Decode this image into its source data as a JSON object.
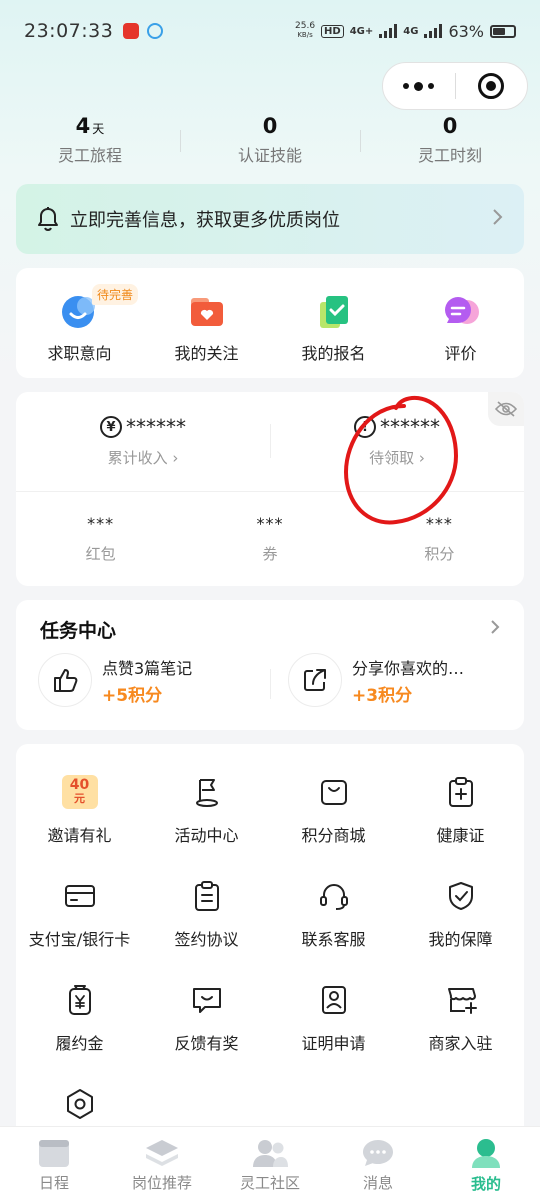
{
  "status_bar": {
    "time": "23:07:33",
    "net_speed_value": "25.6",
    "net_speed_unit": "KB/s",
    "hd_badge": "HD",
    "signal_1": "4G+",
    "signal_2": "4G",
    "battery_percent": "63%",
    "battery_level": 0.63
  },
  "capsule": {
    "more_icon": "more-dots-icon",
    "close_icon": "target-icon"
  },
  "stats": [
    {
      "value": "4",
      "unit": "天",
      "label": "灵工旅程"
    },
    {
      "value": "0",
      "unit": "",
      "label": "认证技能"
    },
    {
      "value": "0",
      "unit": "",
      "label": "灵工时刻"
    }
  ],
  "notice": {
    "text": "立即完善信息，获取更多优质岗位",
    "icon": "bell-icon"
  },
  "quick_actions": {
    "pending_tag": "待完善",
    "items": [
      {
        "label": "求职意向",
        "icon": "smile-face-icon",
        "color": "#3a8ff0"
      },
      {
        "label": "我的关注",
        "icon": "heart-folder-icon",
        "color": "#f25c3b"
      },
      {
        "label": "我的报名",
        "icon": "check-doc-icon",
        "color": "#26c281"
      },
      {
        "label": "评价",
        "icon": "chat-bubble-icon",
        "color": "#b45cf0"
      }
    ]
  },
  "money": {
    "income_value": "******",
    "income_label": "累计收入",
    "pending_value": "******",
    "pending_label": "待领取",
    "mini": [
      {
        "value": "***",
        "label": "红包"
      },
      {
        "value": "***",
        "label": "券"
      },
      {
        "value": "***",
        "label": "积分"
      }
    ]
  },
  "tasks": {
    "title": "任务中心",
    "items": [
      {
        "name": "点赞3篇笔记",
        "reward": "+5积分",
        "icon": "thumbs-up-icon"
      },
      {
        "name": "分享你喜欢的…",
        "reward": "+3积分",
        "icon": "share-icon"
      }
    ]
  },
  "grid": {
    "badge_text_top": "40",
    "badge_text_bottom": "元",
    "items": [
      {
        "label": "邀请有礼",
        "icon": "gift-coupon-icon"
      },
      {
        "label": "活动中心",
        "icon": "flag-icon"
      },
      {
        "label": "积分商城",
        "icon": "shopping-bag-icon"
      },
      {
        "label": "健康证",
        "icon": "health-clipboard-icon"
      },
      {
        "label": "支付宝/银行卡",
        "icon": "card-icon"
      },
      {
        "label": "签约协议",
        "icon": "contract-icon"
      },
      {
        "label": "联系客服",
        "icon": "headset-icon"
      },
      {
        "label": "我的保障",
        "icon": "shield-check-icon"
      },
      {
        "label": "履约金",
        "icon": "yuan-bag-icon"
      },
      {
        "label": "反馈有奖",
        "icon": "feedback-icon"
      },
      {
        "label": "证明申请",
        "icon": "id-card-icon"
      },
      {
        "label": "商家入驻",
        "icon": "store-plus-icon"
      },
      {
        "label": "",
        "icon": "settings-hex-icon"
      }
    ]
  },
  "tabbar": {
    "items": [
      {
        "label": "日程",
        "icon": "calendar-icon",
        "active": false
      },
      {
        "label": "岗位推荐",
        "icon": "layers-icon",
        "active": false
      },
      {
        "label": "灵工社区",
        "icon": "people-icon",
        "active": false
      },
      {
        "label": "消息",
        "icon": "message-icon",
        "active": false
      },
      {
        "label": "我的",
        "icon": "profile-icon",
        "active": true
      }
    ],
    "active_color": "#2bbd8f"
  }
}
